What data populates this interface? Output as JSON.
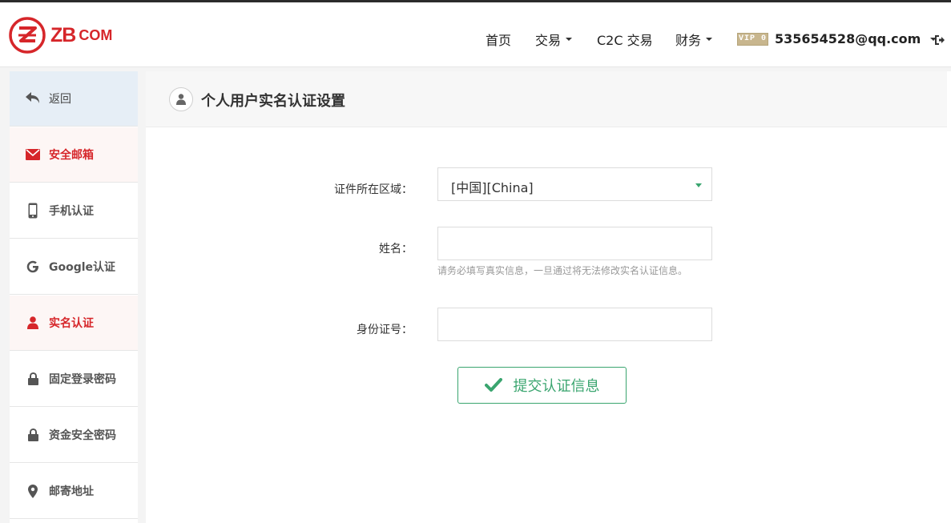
{
  "brand": {
    "name": "ZB",
    "suffix": "COM",
    "color": "#d6262a"
  },
  "nav": {
    "home": "首页",
    "trade": "交易",
    "c2c": "C2C 交易",
    "finance": "财务",
    "vip_badge": "VIP 0",
    "user_email": "535654528@qq.com"
  },
  "sidebar": {
    "items": [
      {
        "label": "返回",
        "icon": "back-arrow-icon"
      },
      {
        "label": "安全邮箱",
        "icon": "envelope-icon"
      },
      {
        "label": "手机认证",
        "icon": "mobile-phone-icon"
      },
      {
        "label": "Google认证",
        "icon": "google-icon"
      },
      {
        "label": "实名认证",
        "icon": "user-icon"
      },
      {
        "label": "固定登录密码",
        "icon": "lock-icon"
      },
      {
        "label": "资金安全密码",
        "icon": "lock-icon"
      },
      {
        "label": "邮寄地址",
        "icon": "map-marker-icon"
      }
    ]
  },
  "main": {
    "title": "个人用户实名认证设置",
    "form": {
      "region_label": "证件所在区域：",
      "region_value": "[中国][China]",
      "name_label": "姓名：",
      "name_value": "",
      "name_hint": "请务必填写真实信息，一旦通过将无法修改实名认证信息。",
      "id_label": "身份证号：",
      "id_value": "",
      "submit_label": "提交认证信息"
    }
  },
  "colors": {
    "accent_red": "#d6262a",
    "accent_green": "#3aa56f"
  }
}
